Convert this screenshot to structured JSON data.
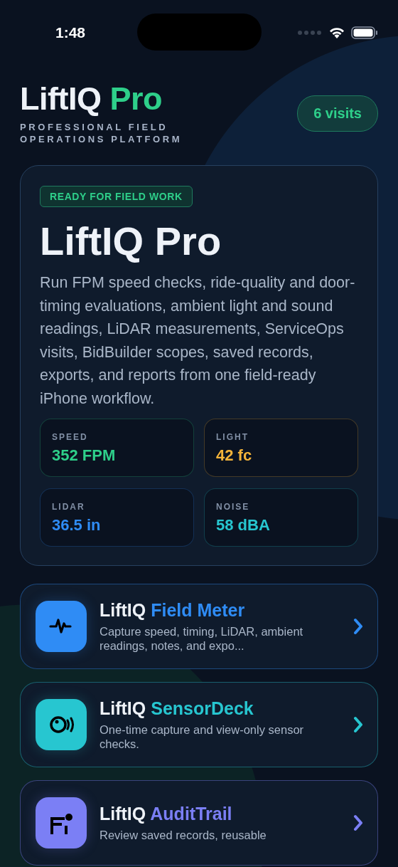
{
  "status_bar": {
    "time": "1:48"
  },
  "header": {
    "title": "LiftIQ",
    "title_accent": "Pro",
    "subtitle": "PROFESSIONAL FIELD OPERATIONS PLATFORM",
    "visits": "6 visits"
  },
  "hero": {
    "badge": "READY FOR FIELD WORK",
    "title": "LiftIQ Pro",
    "description": "Run FPM speed checks, ride-quality and door-timing evaluations, ambient light and sound readings, LiDAR measurements, ServiceOps visits, BidBuilder scopes, saved records, exports, and reports from one field-ready iPhone workflow.",
    "metrics": [
      {
        "label": "SPEED",
        "value": "352 FPM",
        "color": "#2ecf8a"
      },
      {
        "label": "LIGHT",
        "value": "42 fc",
        "color": "#f5b43a"
      },
      {
        "label": "LIDAR",
        "value": "36.5 in",
        "color": "#2f8cf5"
      },
      {
        "label": "NOISE",
        "value": "58 dBA",
        "color": "#27c6d0"
      }
    ]
  },
  "apps": [
    {
      "kind": "pulse",
      "brand": "LiftIQ",
      "name": "Field Meter",
      "description": "Capture speed, timing, LiDAR, ambient readings, notes, and expo...",
      "color": "#2f8cf5"
    },
    {
      "kind": "sensor",
      "brand": "LiftIQ",
      "name": "SensorDeck",
      "description": "One-time capture and view-only sensor checks.",
      "color": "#27c6d0"
    },
    {
      "kind": "audit",
      "brand": "LiftIQ",
      "name": "AuditTrail",
      "description": "Review saved records, reusable",
      "color": "#7b7ff5"
    }
  ]
}
